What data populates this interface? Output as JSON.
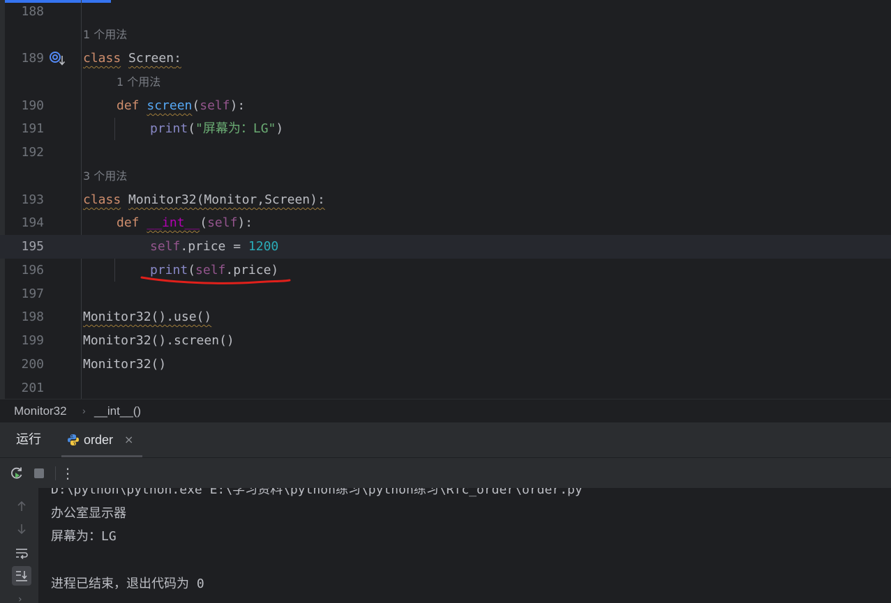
{
  "editor": {
    "lines": [
      {
        "no": "188"
      },
      {
        "hint": "1 个用法"
      },
      {
        "no": "189",
        "tokens": [
          "class",
          "Screen",
          ":"
        ]
      },
      {
        "hint": "1 个用法"
      },
      {
        "no": "190",
        "tokens": [
          "def",
          "screen",
          "(",
          "self",
          "):"
        ]
      },
      {
        "no": "191",
        "tokens": [
          "print",
          "(",
          "\"屏幕为：LG\"",
          ")"
        ]
      },
      {
        "no": "192"
      },
      {
        "hint": "3 个用法"
      },
      {
        "no": "193",
        "tokens": [
          "class",
          "Monitor32(Monitor,Screen):"
        ]
      },
      {
        "no": "194",
        "tokens": [
          "def",
          "__int__",
          "(",
          "self",
          "):"
        ]
      },
      {
        "no": "195",
        "tokens": [
          "self",
          ".price = ",
          "1200"
        ]
      },
      {
        "no": "196",
        "tokens": [
          "print",
          "(",
          "self",
          ".price",
          ")"
        ]
      },
      {
        "no": "197"
      },
      {
        "no": "198",
        "tokens": [
          "Monitor32().use()"
        ]
      },
      {
        "no": "199",
        "tokens": [
          "Monitor32().screen()"
        ]
      },
      {
        "no": "200",
        "tokens": [
          "Monitor32()"
        ]
      },
      {
        "no": "201"
      }
    ],
    "current_line": "195",
    "red_underline_line": "196"
  },
  "breadcrumb": {
    "items": [
      "Monitor32",
      "__int__()"
    ],
    "separator": "›"
  },
  "run": {
    "title": "运行",
    "tab_label": "order",
    "tab_close": "×",
    "toolbar": {
      "rerun_icon": "rerun-icon",
      "stop_icon": "stop-icon",
      "more_icon": "more-vertical-icon",
      "more_glyph": "⋮"
    },
    "side_icons": [
      "scroll-up-icon",
      "scroll-down-icon",
      "soft-wrap-icon",
      "scroll-to-end-icon"
    ],
    "console": {
      "lines": [
        "D:\\python\\python.exe E:\\学习资料\\python练习\\python练习\\Rfc_order\\order.py",
        "办公室显示器",
        "屏幕为：LG",
        "",
        "进程已结束，退出代码为 0"
      ]
    }
  },
  "colors": {
    "editor_bg": "#1e1f22",
    "keyword": "#cf8e6d",
    "function": "#56a8f5",
    "self": "#94558d",
    "dunder": "#b200b2",
    "string": "#6aab73",
    "number": "#2aacb8",
    "builtin": "#8888c6",
    "annotation_red": "#e0201b",
    "accent": "#3574f0"
  }
}
